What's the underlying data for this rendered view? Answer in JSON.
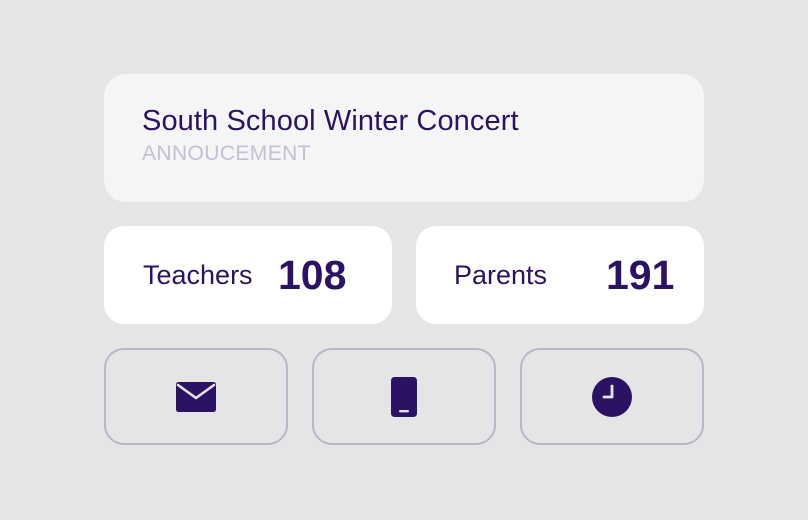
{
  "announcement": {
    "title": "South School Winter Concert",
    "type_label": "ANNOUCEMENT"
  },
  "stats": {
    "teachers": {
      "label": "Teachers",
      "value": "108"
    },
    "parents": {
      "label": "Parents",
      "value": "191"
    }
  },
  "actions": [
    {
      "name": "email",
      "icon": "envelope-icon"
    },
    {
      "name": "sms",
      "icon": "mobile-phone-icon"
    },
    {
      "name": "schedule",
      "icon": "clock-icon"
    }
  ],
  "colors": {
    "background": "#e5e5e5",
    "primary_text": "#2c1264",
    "muted_text": "#c6bdd6",
    "card_announcement": "#f5f5f5",
    "card_stat": "#ffffff",
    "button_border": "#b9b4c7"
  }
}
